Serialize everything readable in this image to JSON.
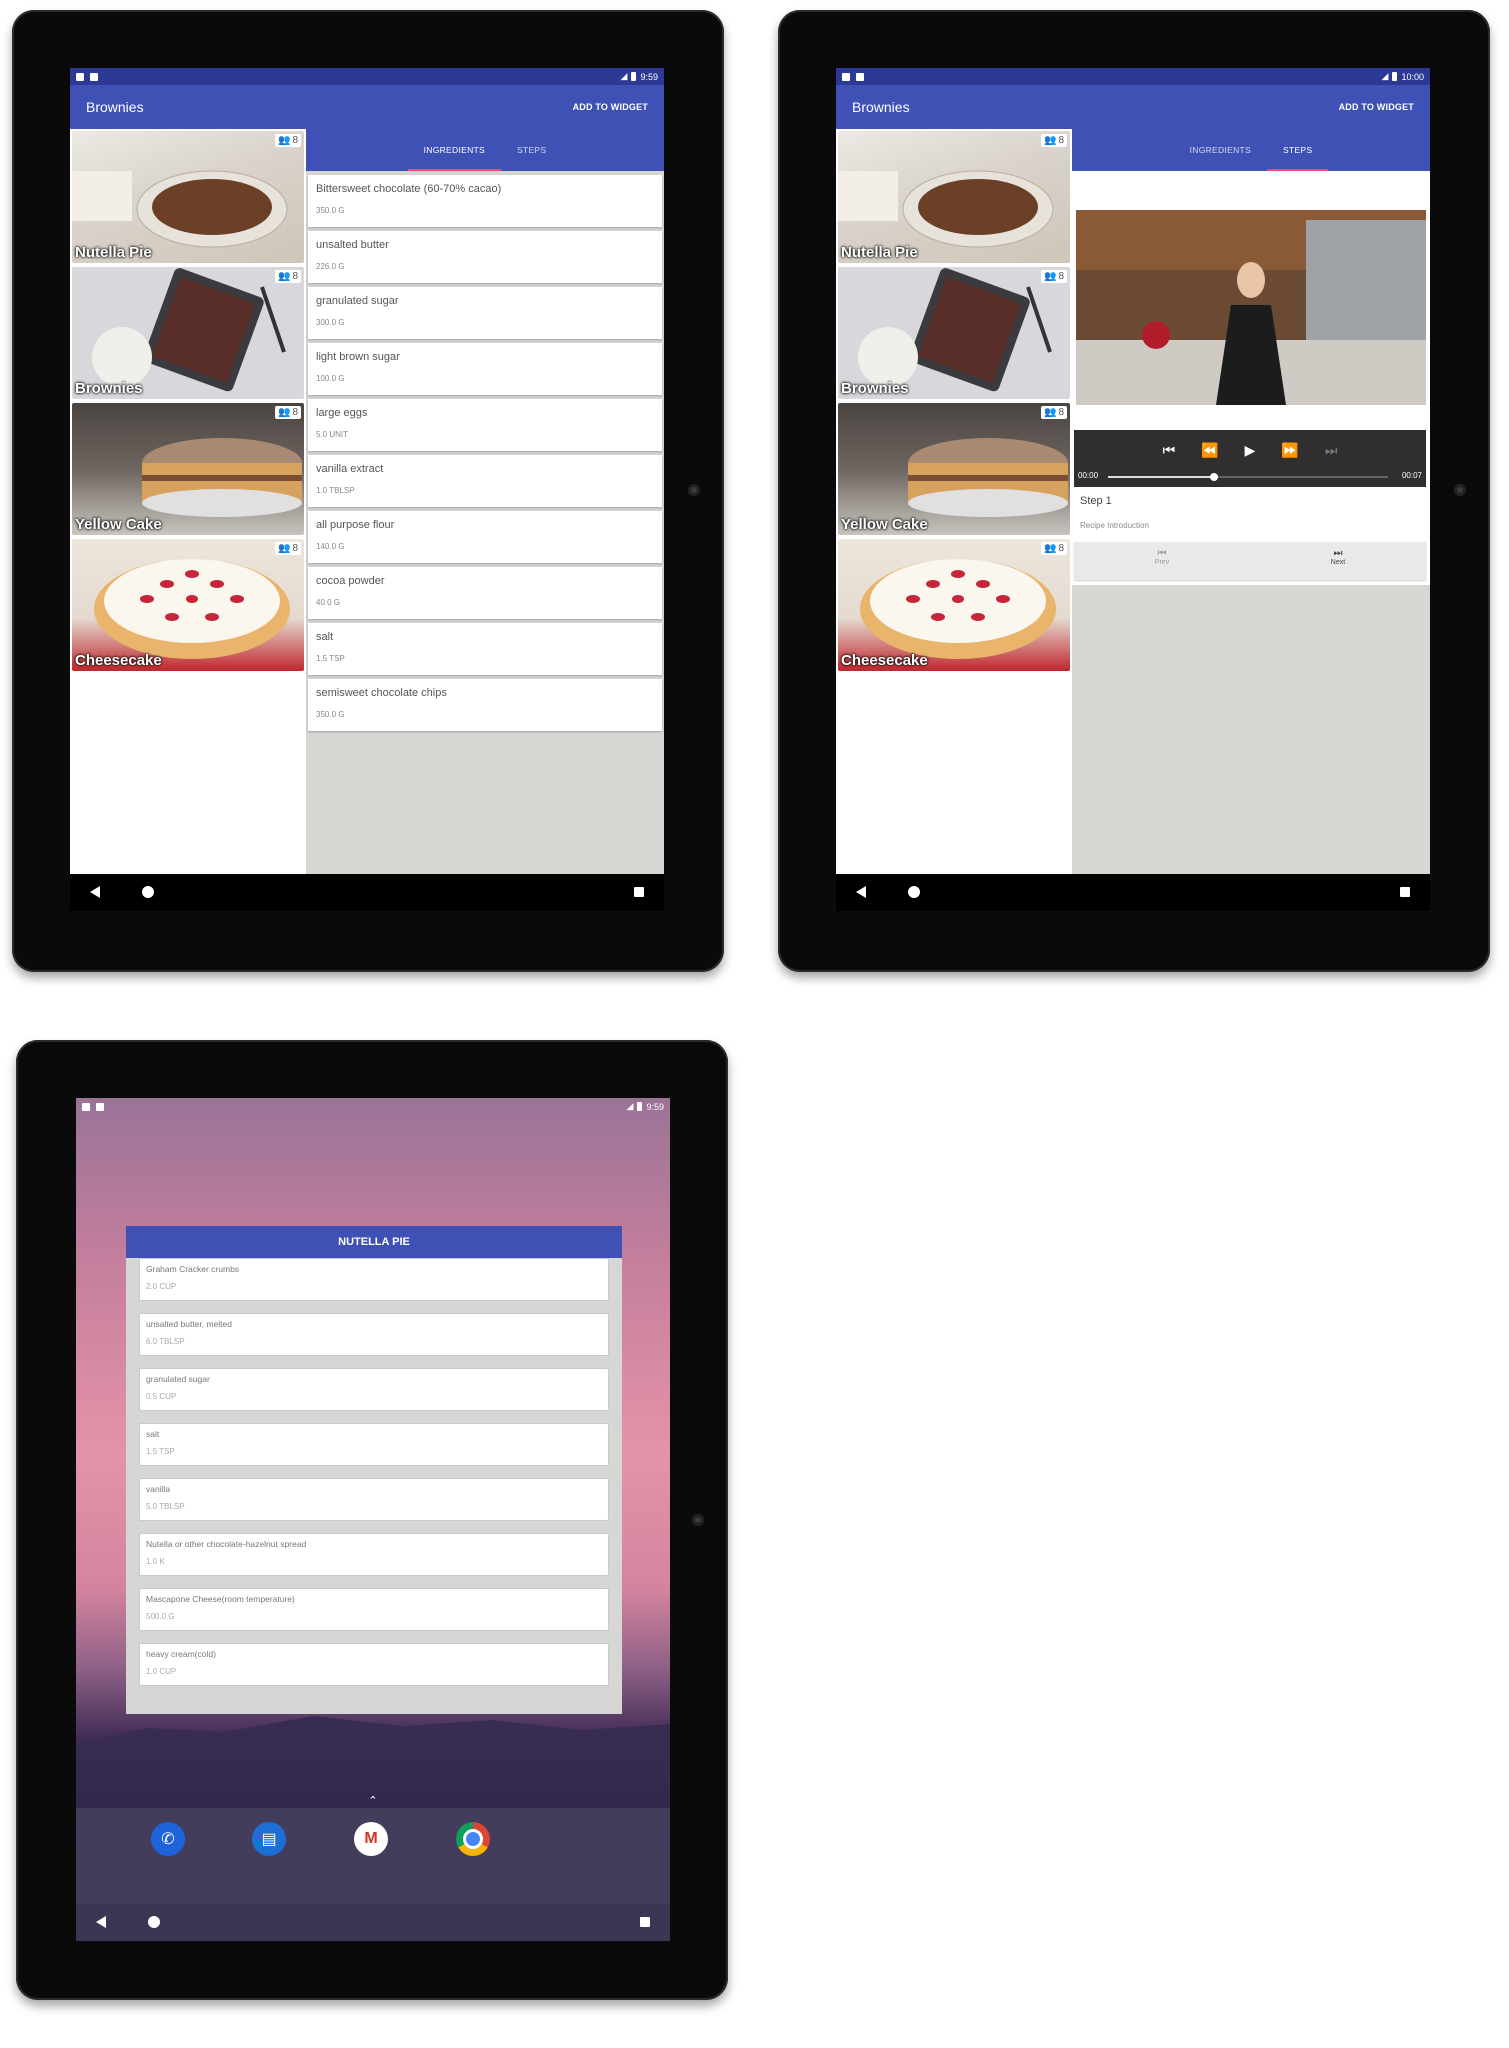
{
  "status": {
    "time_a": "9:59",
    "time_b": "10:00",
    "time_c": "9:59"
  },
  "appbar": {
    "title": "Brownies",
    "action": "ADD TO WIDGET"
  },
  "tabs": {
    "ingredients": "INGREDIENTS",
    "steps": "STEPS"
  },
  "recipes": [
    {
      "name": "Nutella Pie",
      "servings": "8"
    },
    {
      "name": "Brownies",
      "servings": "8"
    },
    {
      "name": "Yellow Cake",
      "servings": "8"
    },
    {
      "name": "Cheesecake",
      "servings": "8"
    }
  ],
  "ingredients": [
    {
      "name": "Bittersweet chocolate (60-70% cacao)",
      "qty": "350.0 G"
    },
    {
      "name": "unsalted butter",
      "qty": "226.0 G"
    },
    {
      "name": "granulated sugar",
      "qty": "300.0 G"
    },
    {
      "name": "light brown sugar",
      "qty": "100.0 G"
    },
    {
      "name": "large eggs",
      "qty": "5.0 UNIT"
    },
    {
      "name": "vanilla extract",
      "qty": "1.0 TBLSP"
    },
    {
      "name": "all purpose flour",
      "qty": "140.0 G"
    },
    {
      "name": "cocoa powder",
      "qty": "40.0 G"
    },
    {
      "name": "salt",
      "qty": "1.5 TSP"
    },
    {
      "name": "semisweet chocolate chips",
      "qty": "350.0 G"
    }
  ],
  "player": {
    "elapsed": "00:00",
    "duration": "00:07",
    "progress": 0.38
  },
  "step": {
    "title": "Step 1",
    "description": "Recipe Introduction",
    "prev": "Prev",
    "next": "Next"
  },
  "widget": {
    "title": "NUTELLA PIE",
    "items": [
      {
        "name": "Graham Cracker crumbs",
        "qty": "2.0 CUP"
      },
      {
        "name": "unsalted butter, melted",
        "qty": "6.0 TBLSP"
      },
      {
        "name": "granulated sugar",
        "qty": "0.5 CUP"
      },
      {
        "name": "salt",
        "qty": "1.5 TSP"
      },
      {
        "name": "vanilla",
        "qty": "5.0 TBLSP"
      },
      {
        "name": "Nutella or other chocolate-hazelnut spread",
        "qty": "1.0 K"
      },
      {
        "name": "Mascapone Cheese(room temperature)",
        "qty": "500.0 G"
      },
      {
        "name": "heavy cream(cold)",
        "qty": "1.0 CUP"
      }
    ]
  },
  "dock_apps": [
    "phone-icon",
    "messages-icon",
    "gmail-icon",
    "chrome-icon"
  ]
}
